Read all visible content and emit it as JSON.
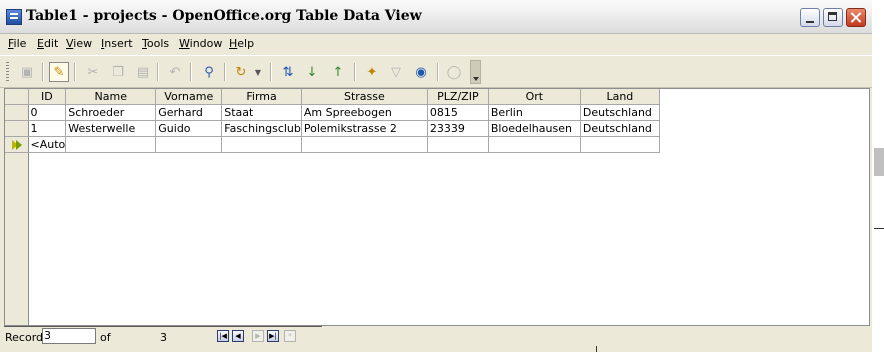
{
  "window": {
    "title": "Table1 - projects - OpenOffice.org Table Data View"
  },
  "menubar": {
    "items": [
      {
        "pre": "",
        "u": "F",
        "post": "ile"
      },
      {
        "pre": "",
        "u": "E",
        "post": "dit"
      },
      {
        "pre": "",
        "u": "V",
        "post": "iew"
      },
      {
        "pre": "",
        "u": "I",
        "post": "nsert"
      },
      {
        "pre": "",
        "u": "T",
        "post": "ools"
      },
      {
        "pre": "",
        "u": "W",
        "post": "indow"
      },
      {
        "pre": "",
        "u": "H",
        "post": "elp"
      }
    ]
  },
  "toolbar": {
    "icons": [
      "save-record-icon",
      "edit-data-icon",
      "cut-icon",
      "copy-icon",
      "paste-icon",
      "undo-icon",
      "find-record-icon",
      "refresh-icon",
      "sort-icon",
      "sort-ascending-icon",
      "sort-descending-icon",
      "autofilter-icon",
      "standard-filter-icon",
      "remove-filter-icon",
      "data-to-text-icon"
    ]
  },
  "table": {
    "columns": [
      "ID",
      "Name",
      "Vorname",
      "Firma",
      "Strasse",
      "PLZ/ZIP",
      "Ort",
      "Land"
    ],
    "rows": [
      [
        "0",
        "Schroeder",
        "Gerhard",
        "Staat",
        "Am Spreebogen",
        "0815",
        "Berlin",
        "Deutschland"
      ],
      [
        "1",
        "Westerwelle",
        "Guido",
        "Faschingsclub",
        "Polemikstrasse 2",
        "23339",
        "Bloedelhausen",
        "Deutschland"
      ],
      [
        "<Auto",
        "",
        "",
        "",
        "",
        "",
        "",
        ""
      ]
    ]
  },
  "navigation": {
    "record_label": "Record",
    "record_value": "3",
    "of_label": "of",
    "total": "3"
  },
  "colors": {
    "title_bar": "#eeeeee",
    "chrome": "#ece9d8",
    "grid_line": "#a8a8a8",
    "current_row_indicator": "#b8b800"
  }
}
